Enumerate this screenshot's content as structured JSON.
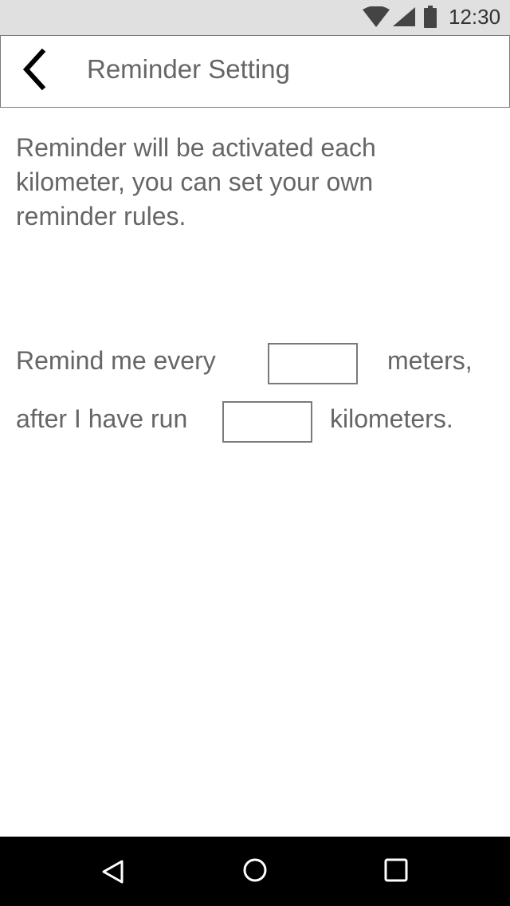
{
  "status_bar": {
    "time": "12:30",
    "icons": [
      "wifi-icon",
      "cell-signal-icon",
      "battery-icon"
    ]
  },
  "app_bar": {
    "back_icon": "chevron-left-icon",
    "title": "Reminder Setting"
  },
  "content": {
    "description": "Reminder will be activated each kilometer, you can set your own reminder rules.",
    "rule_interval": {
      "prefix": "Remind me every",
      "value": "",
      "suffix": "meters,"
    },
    "rule_start": {
      "prefix": "after I have run",
      "value": "",
      "suffix": "kilometers."
    }
  },
  "nav_bar": {
    "icons": [
      "nav-back-icon",
      "nav-home-icon",
      "nav-recents-icon"
    ]
  },
  "colors": {
    "status_bar_bg": "#e0e0e0",
    "text_gray": "#666666",
    "border_gray": "#7a7a7a",
    "nav_bar_bg": "#000000"
  }
}
